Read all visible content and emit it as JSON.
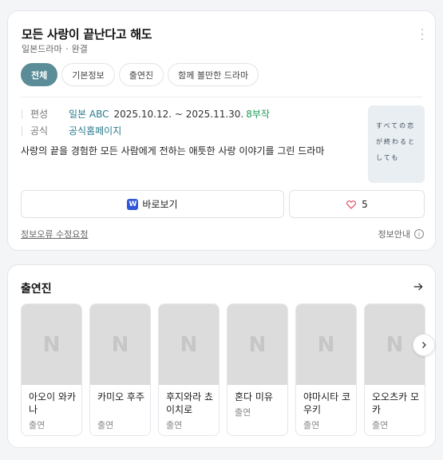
{
  "header": {
    "title": "모든 사랑이 끝난다고 해도",
    "genre": "일본드라마",
    "status": "완결"
  },
  "tabs": [
    {
      "label": "전체",
      "active": true
    },
    {
      "label": "기본정보",
      "active": false
    },
    {
      "label": "출연진",
      "active": false
    },
    {
      "label": "함께 볼만한 드라마",
      "active": false
    }
  ],
  "info": {
    "broadcast_key": "편성",
    "channel": "일본 ABC",
    "dates": "2025.10.12. ~ 2025.11.30.",
    "episodes": "8부작",
    "official_key": "공식",
    "official_link": "공식홈페이지"
  },
  "description": "사랑의 끝을 경험한 모든 사람에게 전하는 애틋한 사랑 이야기를 그린 드라마",
  "poster": {
    "text": "すべての恋が終わるとしても"
  },
  "actions": {
    "watch_logo": "W",
    "watch_label": "바로보기",
    "like_count": "5"
  },
  "footer": {
    "report_label": "정보오류 수정요청",
    "info_label": "정보안내",
    "info_icon": "i"
  },
  "cast_section": {
    "title": "출연진",
    "placeholder_logo": "N",
    "members": [
      {
        "name": "아오이 와카나",
        "role": "출연"
      },
      {
        "name": "카미오 후주",
        "role": "출연"
      },
      {
        "name": "후지와라 쵸이치로",
        "role": "출연"
      },
      {
        "name": "혼다 미유",
        "role": "출연"
      },
      {
        "name": "야마시타 코우키",
        "role": "출연"
      },
      {
        "name": "오오츠카 모카",
        "role": "출연"
      }
    ]
  },
  "colors": {
    "active_tab": "#5a8d97",
    "link": "#2a7a8c",
    "episodes": "#1a9c57",
    "watch_logo": "#2f57d8",
    "heart": "#e04a5f"
  },
  "icons": [
    "more-vertical-icon",
    "watch-logo-icon",
    "heart-icon",
    "info-icon",
    "arrow-right-icon",
    "chevron-right-icon"
  ]
}
